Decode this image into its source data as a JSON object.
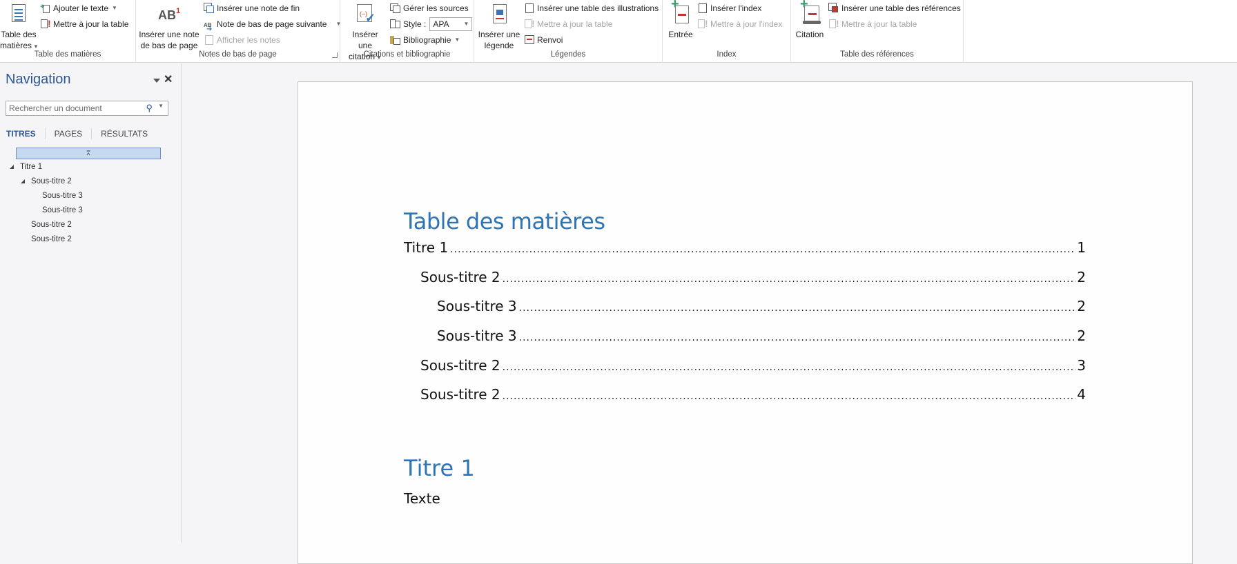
{
  "ribbon": {
    "groups": {
      "toc": {
        "label": "Table des matières",
        "big_button": [
          "Table des",
          "matières"
        ],
        "add_text": "Ajouter le texte",
        "update_table": "Mettre à jour la table"
      },
      "footnotes": {
        "label": "Notes de bas de page",
        "big_button": [
          "Insérer une note",
          "de bas de page"
        ],
        "insert_endnote": "Insérer une note de fin",
        "next_footnote": "Note de bas de page suivante",
        "show_notes": "Afficher les notes",
        "big_icon_text": "AB",
        "big_icon_sup": "1"
      },
      "citations": {
        "label": "Citations et bibliographie",
        "big_button": [
          "Insérer une",
          "citation"
        ],
        "manage_sources": "Gérer les sources",
        "style_label": "Style :",
        "style_value": "APA",
        "bibliography": "Bibliographie"
      },
      "captions": {
        "label": "Légendes",
        "big_button": [
          "Insérer une",
          "légende"
        ],
        "insert_table_figures": "Insérer une table des illustrations",
        "update_table": "Mettre à jour la table",
        "cross_reference": "Renvoi"
      },
      "index": {
        "label": "Index",
        "big_button": "Entrée",
        "insert_index": "Insérer l'index",
        "update_index": "Mettre à jour l'index"
      },
      "authorities": {
        "label": "Table des références",
        "big_button": "Citation",
        "insert_table": "Insérer une table des références",
        "update_table": "Mettre à jour la table"
      }
    }
  },
  "navigation": {
    "title": "Navigation",
    "search_placeholder": "Rechercher un document",
    "tabs": [
      {
        "label": "TITRES",
        "active": true
      },
      {
        "label": "PAGES",
        "active": false
      },
      {
        "label": "RÉSULTATS",
        "active": false
      }
    ],
    "tree": [
      {
        "label": "Titre 1",
        "level": 1,
        "expanded": true
      },
      {
        "label": "Sous-titre 2",
        "level": 2,
        "expanded": true
      },
      {
        "label": "Sous-titre 3",
        "level": 3
      },
      {
        "label": "Sous-titre 3",
        "level": 3
      },
      {
        "label": "Sous-titre 2",
        "level": 2
      },
      {
        "label": "Sous-titre 2",
        "level": 2
      }
    ]
  },
  "document": {
    "toc_title": "Table des matières",
    "toc_entries": [
      {
        "label": "Titre 1",
        "page": "1",
        "level": 1
      },
      {
        "label": "Sous-titre 2",
        "page": "2",
        "level": 2
      },
      {
        "label": "Sous-titre 3",
        "page": "2",
        "level": 3
      },
      {
        "label": "Sous-titre 3",
        "page": "2",
        "level": 3
      },
      {
        "label": "Sous-titre 2",
        "page": "3",
        "level": 2
      },
      {
        "label": "Sous-titre 2",
        "page": "4",
        "level": 2
      }
    ],
    "heading1": "Titre 1",
    "body_text": "Texte"
  },
  "colors": {
    "heading": "#2e74b5",
    "nav_accent": "#2b579a",
    "selection_bar": "#c5d9f1"
  }
}
